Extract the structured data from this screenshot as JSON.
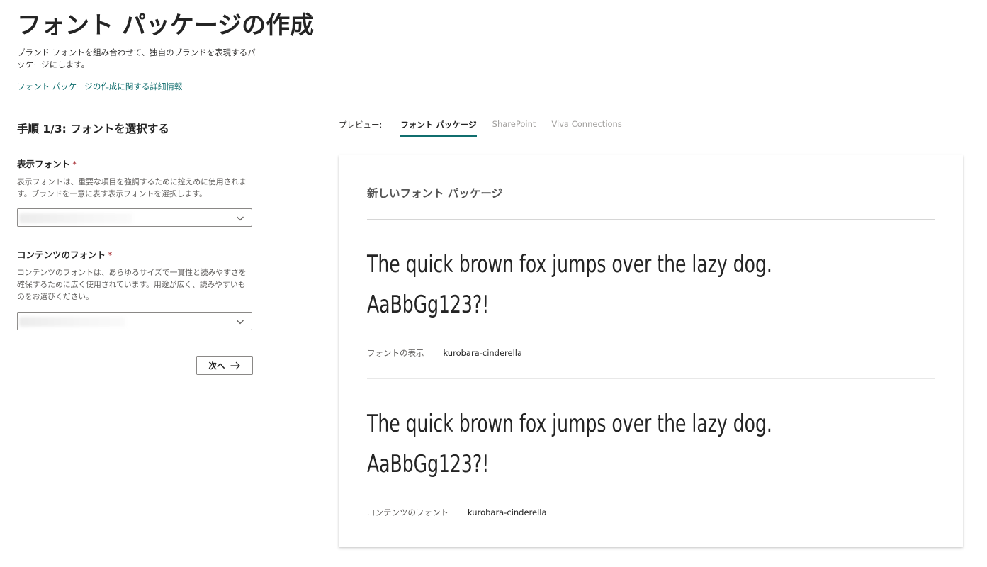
{
  "page": {
    "title": "フォント パッケージの作成",
    "intro": "ブランド フォントを組み合わせて、独自のブランドを表現するパッケージにします。",
    "learn_more_link": "フォント パッケージの作成に関する詳細情報"
  },
  "form": {
    "step_title": "手順 1/3: フォントを選択する",
    "display_font": {
      "label": "表示フォント",
      "required_mark": "*",
      "description": "表示フォントは、重要な項目を強調するために控えめに使用されます。ブランドを一意に表す表示フォントを選択します。",
      "selected_value_obscured": true
    },
    "content_font": {
      "label": "コンテンツのフォント",
      "required_mark": "*",
      "description": "コンテンツのフォントは、あらゆるサイズで一貫性と読みやすさを確保するために広く使用されています。用途が広く、読みやすいものをお選びください。",
      "selected_value_obscured": true
    },
    "next_button": "次へ",
    "icons": {
      "dropdown": "chevron-down-icon",
      "next": "arrow-right-icon"
    }
  },
  "preview": {
    "label": "プレビュー:",
    "tabs": [
      {
        "label": "フォント パッケージ",
        "active": true
      },
      {
        "label": "SharePoint",
        "active": false
      },
      {
        "label": "Viva Connections",
        "active": false
      }
    ],
    "card": {
      "title": "新しいフォント パッケージ",
      "samples": [
        {
          "line1": "The quick brown fox jumps over the lazy dog.",
          "line2": "AaBbGg123?!",
          "meta_label": "フォントの表示",
          "meta_value": "kurobara-cinderella"
        },
        {
          "line1": "The quick brown fox jumps over the lazy dog.",
          "line2": "AaBbGg123?!",
          "meta_label": "コンテンツのフォント",
          "meta_value": "kurobara-cinderella"
        }
      ]
    }
  },
  "colors": {
    "accent": "#106e6e",
    "required": "#a4262c",
    "text": "#242424",
    "muted": "#605e5c",
    "inactive_tab": "#a19f9d"
  }
}
